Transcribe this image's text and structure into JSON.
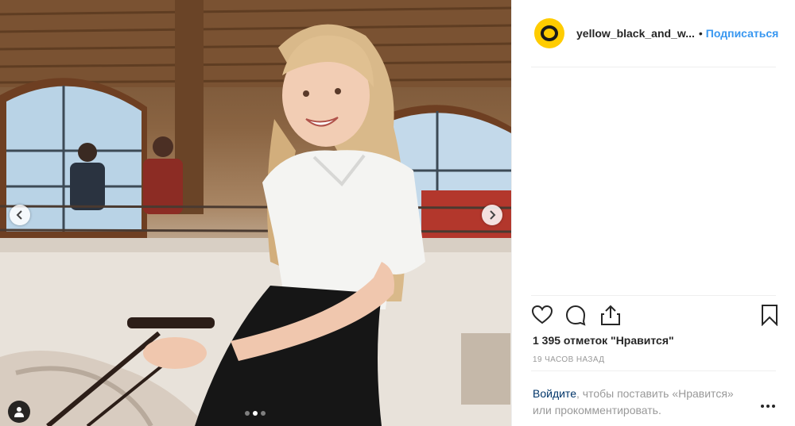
{
  "post": {
    "username": "yellow_black_and_w...",
    "separator": "•",
    "follow_label": "Подписаться",
    "likes_text": "1 395 отметок \"Нравится\"",
    "timestamp": "19 ЧАСОВ НАЗАД",
    "login_link": "Войдите",
    "login_rest": ", чтобы поставить «Нравится» или прокомментировать."
  },
  "carousel": {
    "slides": 3,
    "active_slide": 2
  },
  "icons": {
    "avatar": "yellow-ring-avatar",
    "prev": "chevron-left-icon",
    "next": "chevron-right-icon",
    "tag": "user-tag-icon",
    "like": "heart-icon",
    "comment": "comment-icon",
    "share": "share-icon",
    "save": "bookmark-icon",
    "more": "more-dots-icon"
  },
  "colors": {
    "accent": "#3897f0",
    "avatar_yellow": "#ffcc00",
    "muted": "#999999",
    "text": "#262626"
  }
}
